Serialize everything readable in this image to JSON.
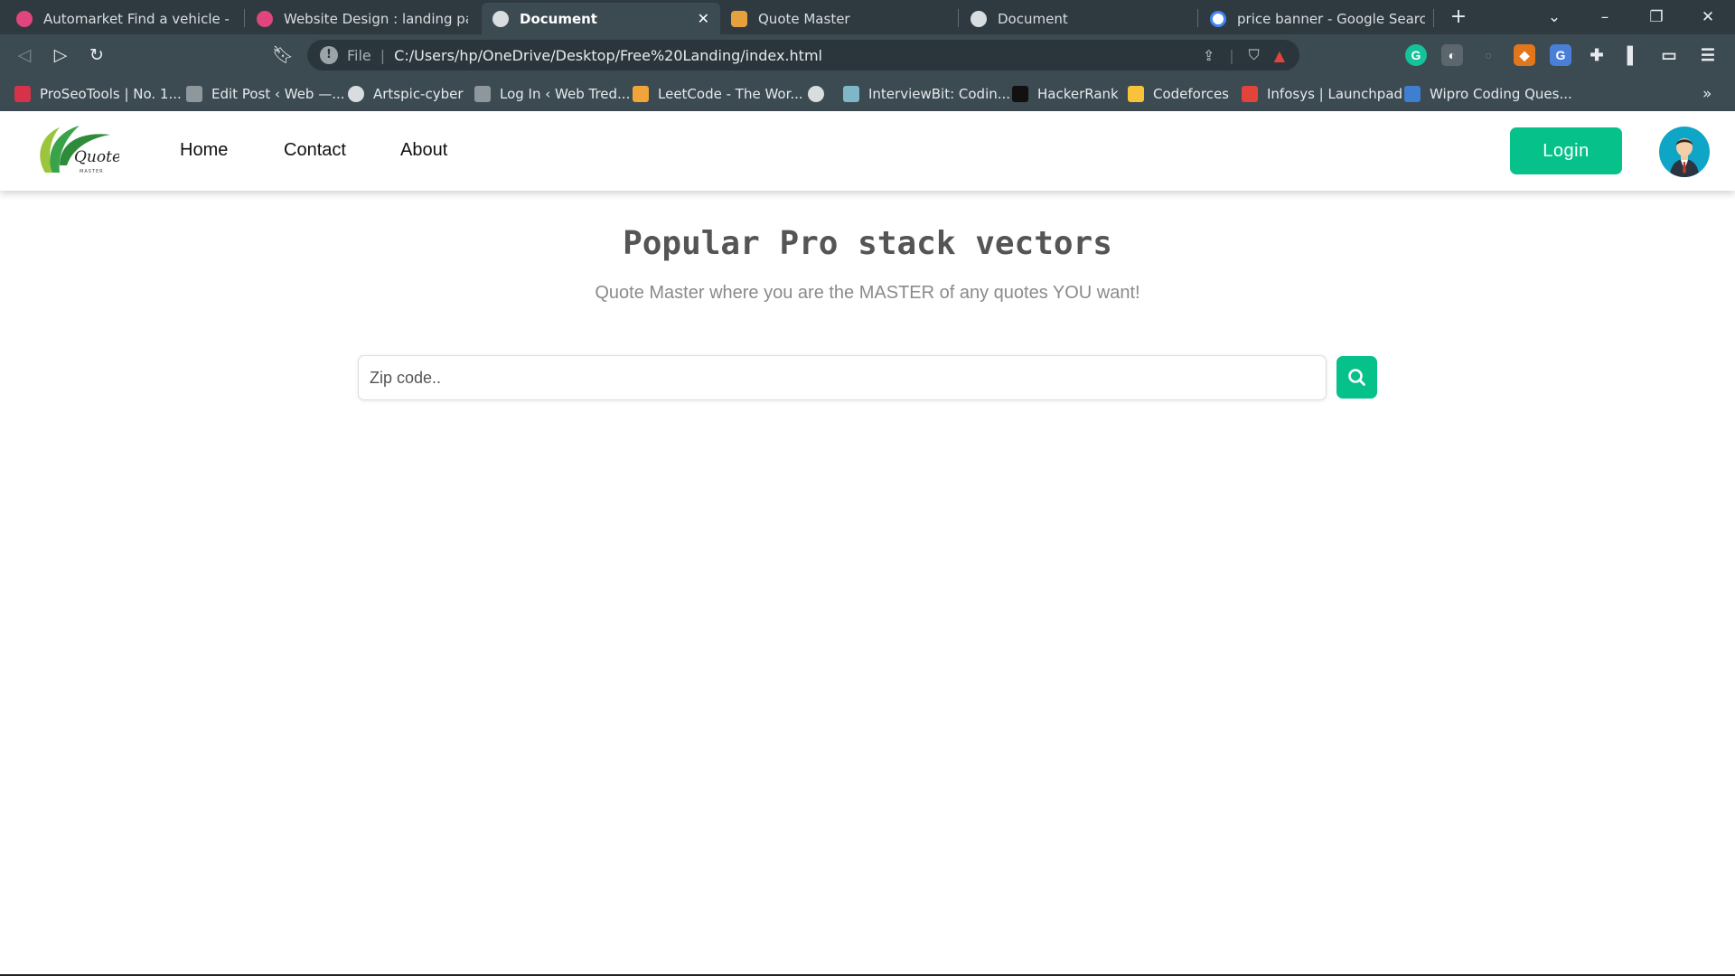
{
  "browser": {
    "tabs": [
      {
        "title": "Automarket Find a vehicle - search",
        "favicon": "dribbble-icon",
        "active": false
      },
      {
        "title": "Website Design : landing page by",
        "favicon": "dribbble-icon",
        "active": false
      },
      {
        "title": "Document",
        "favicon": "globe-icon",
        "active": true
      },
      {
        "title": "Quote Master",
        "favicon": "quote-master-icon",
        "active": false
      },
      {
        "title": "Document",
        "favicon": "globe-icon",
        "active": false
      },
      {
        "title": "price banner - Google Search",
        "favicon": "google-icon",
        "active": false
      }
    ],
    "address": {
      "scheme": "File",
      "url": "C:/Users/hp/OneDrive/Desktop/Free%20Landing/index.html"
    },
    "bookmarks": [
      {
        "label": "ProSeoTools | No. 1..."
      },
      {
        "label": "Edit Post ‹ Web —..."
      },
      {
        "label": "Artspic-cyber"
      },
      {
        "label": "Log In ‹ Web Tred..."
      },
      {
        "label": "LeetCode - The Wor..."
      },
      {
        "label": ""
      },
      {
        "label": "InterviewBit: Codin..."
      },
      {
        "label": "HackerRank"
      },
      {
        "label": "Codeforces"
      },
      {
        "label": "Infosys | Launchpad"
      },
      {
        "label": "Wipro Coding Ques..."
      }
    ],
    "colors": {
      "chrome": "#3c4a52",
      "tabstrip": "#2f3a40"
    }
  },
  "site": {
    "logo_text": "Quote",
    "logo_sub": "MASTER",
    "nav": [
      {
        "label": "Home"
      },
      {
        "label": "Contact"
      },
      {
        "label": "About"
      }
    ],
    "login_label": "Login",
    "accent": "#06c189"
  },
  "hero": {
    "title": "Popular Pro stack vectors",
    "subtitle": "Quote Master where you are the MASTER of any quotes YOU want!"
  },
  "search": {
    "placeholder": "Zip code..",
    "value": ""
  }
}
